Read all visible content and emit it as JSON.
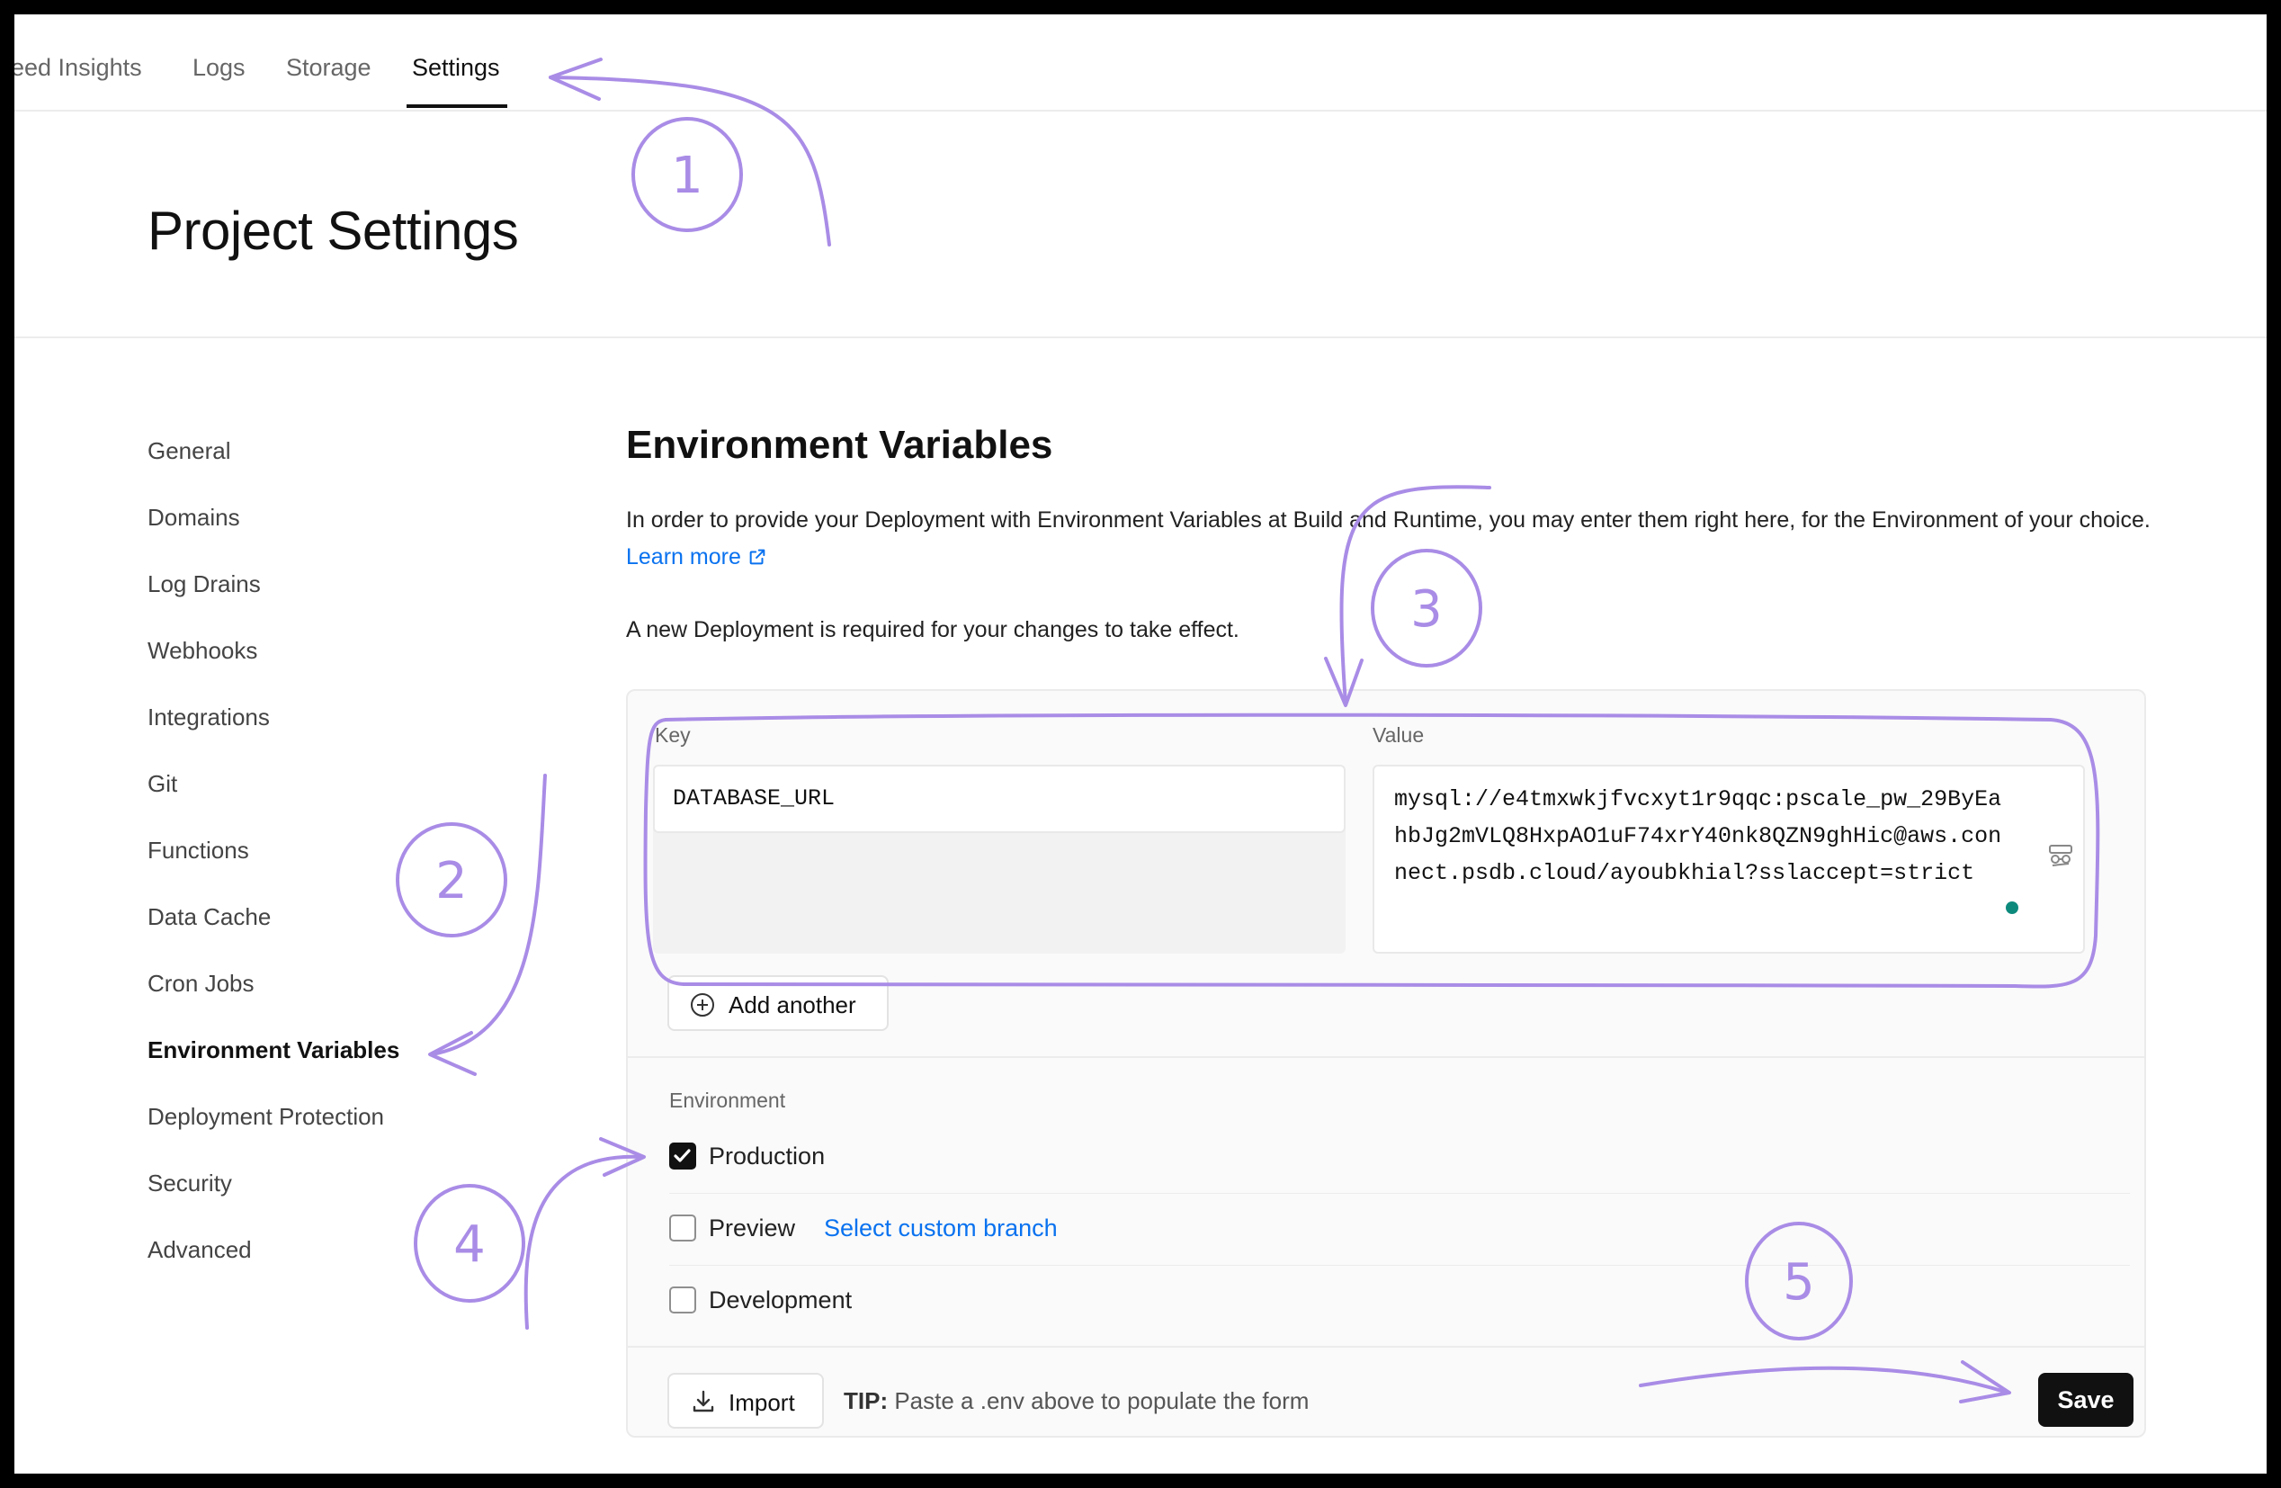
{
  "topnav": {
    "tabs": [
      {
        "label": "eed Insights"
      },
      {
        "label": "Logs"
      },
      {
        "label": "Storage"
      },
      {
        "label": "Settings",
        "active": true
      }
    ]
  },
  "header": {
    "title": "Project Settings"
  },
  "sidebar": {
    "items": [
      {
        "label": "General"
      },
      {
        "label": "Domains"
      },
      {
        "label": "Log Drains"
      },
      {
        "label": "Webhooks"
      },
      {
        "label": "Integrations"
      },
      {
        "label": "Git"
      },
      {
        "label": "Functions"
      },
      {
        "label": "Data Cache"
      },
      {
        "label": "Cron Jobs"
      },
      {
        "label": "Environment Variables",
        "active": true
      },
      {
        "label": "Deployment Protection"
      },
      {
        "label": "Security"
      },
      {
        "label": "Advanced"
      }
    ]
  },
  "main": {
    "title": "Environment Variables",
    "description": "In order to provide your Deployment with Environment Variables at Build and Runtime, you may enter them right here, for the Environment of your choice.",
    "learn_more": "Learn more",
    "note": "A new Deployment is required for your changes to take effect.",
    "form": {
      "key_label": "Key",
      "value_label": "Value",
      "key_value": "DATABASE_URL",
      "value_value": "mysql://e4tmxwkjfvcxyt1r9qqc:pscale_pw_29ByEahbJg2mVLQ8HxpAO1uF74xrY40nk8QZN9ghHic@aws.connect.psdb.cloud/ayoubkhial?sslaccept=strict",
      "add_another": "Add another",
      "environment_label": "Environment",
      "environments": [
        {
          "label": "Production",
          "checked": true
        },
        {
          "label": "Preview",
          "checked": false,
          "link": "Select custom branch"
        },
        {
          "label": "Development",
          "checked": false
        }
      ],
      "import_label": "Import",
      "tip_prefix": "TIP:",
      "tip_text": "Paste a .env above to populate the form",
      "save_label": "Save"
    }
  },
  "annotations": [
    "1",
    "2",
    "3",
    "4",
    "5"
  ],
  "colors": {
    "accent": "#0a72ef",
    "annotation": "#a98ce6",
    "status": "#0e8a7d"
  }
}
